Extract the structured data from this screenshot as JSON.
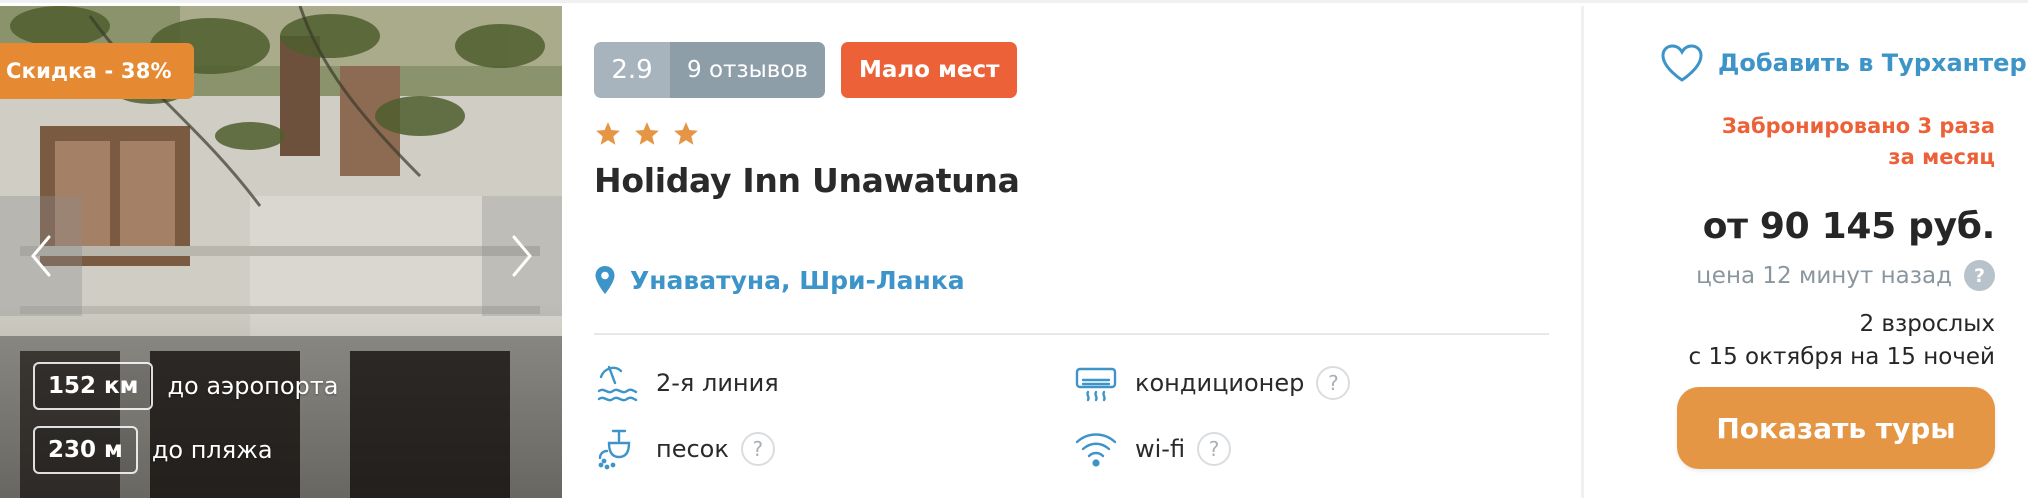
{
  "photo": {
    "discount_label": "Скидка - 38%",
    "distances": [
      {
        "value": "152 км",
        "label": "до аэропорта"
      },
      {
        "value": "230 м",
        "label": "до пляжа"
      }
    ]
  },
  "hotel": {
    "rating_score": "2.9",
    "reviews_label": "9 отзывов",
    "few_seats_label": "Мало мест",
    "stars": 3,
    "name": "Holiday Inn Unawatuna",
    "location": "Унаватуна, Шри-Ланка",
    "features": [
      {
        "icon": "beach-icon",
        "label": "2-я линия",
        "has_help": false
      },
      {
        "icon": "air-conditioner-icon",
        "label": "кондиционер",
        "has_help": true,
        "help": "?"
      },
      {
        "icon": "sand-icon",
        "label": "песок",
        "has_help": true,
        "help": "?"
      },
      {
        "icon": "wifi-icon",
        "label": "wi-fi",
        "has_help": true,
        "help": "?"
      }
    ]
  },
  "offer": {
    "favorite_label": "Добавить в Турхантер",
    "booked_line1": "Забронировано 3 раза",
    "booked_line2": "за месяц",
    "price": "от 90 145 руб.",
    "price_age": "цена 12 минут назад",
    "price_help": "?",
    "guests_line1": "2 взрослых",
    "guests_line2": "с 15 октября на 15 ночей",
    "show_button": "Показать туры"
  },
  "colors": {
    "accent_blue": "#3d94c8",
    "discount_orange": "#e58a33",
    "alert_red": "#ec6137",
    "button_orange": "#e59645",
    "star": "#e59645"
  }
}
